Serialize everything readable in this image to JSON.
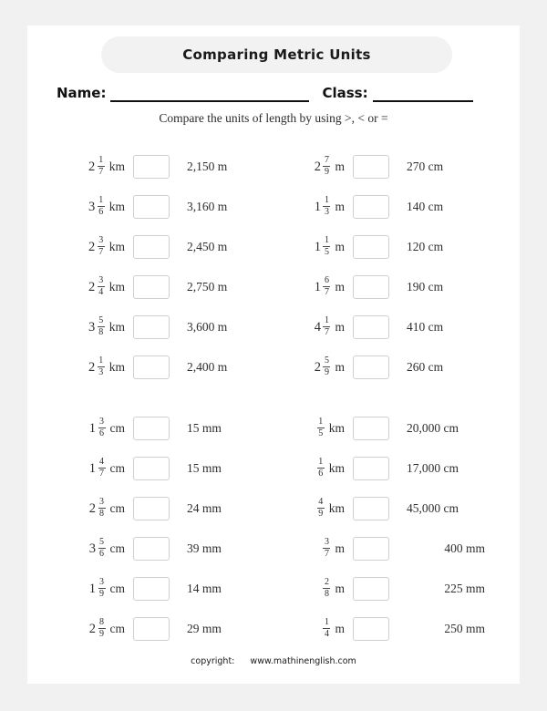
{
  "title": "Comparing Metric Units",
  "fields": {
    "name_label": "Name:",
    "class_label": "Class:"
  },
  "instruction": "Compare the units of length by using >, < or =",
  "footer": {
    "copyright_label": "copyright:",
    "site": "www.mathinenglish.com"
  },
  "blocks": [
    {
      "rows": [
        {
          "left": {
            "whole": "2",
            "num": "1",
            "den": "7",
            "unit": "km"
          },
          "answer": "",
          "right": "2,150 m",
          "right_align": false
        },
        {
          "left": {
            "whole": "3",
            "num": "1",
            "den": "6",
            "unit": "km"
          },
          "answer": "",
          "right": "3,160 m",
          "right_align": false
        },
        {
          "left": {
            "whole": "2",
            "num": "3",
            "den": "7",
            "unit": "km"
          },
          "answer": "",
          "right": "2,450 m",
          "right_align": false
        },
        {
          "left": {
            "whole": "2",
            "num": "3",
            "den": "4",
            "unit": "km"
          },
          "answer": "",
          "right": "2,750 m",
          "right_align": false
        },
        {
          "left": {
            "whole": "3",
            "num": "5",
            "den": "8",
            "unit": "km"
          },
          "answer": "",
          "right": "3,600 m",
          "right_align": false
        },
        {
          "left": {
            "whole": "2",
            "num": "1",
            "den": "3",
            "unit": "km"
          },
          "answer": "",
          "right": "2,400 m",
          "right_align": false
        }
      ],
      "rows_right": [
        {
          "left": {
            "whole": "2",
            "num": "7",
            "den": "9",
            "unit": "m"
          },
          "answer": "",
          "right": "270 cm",
          "right_align": false
        },
        {
          "left": {
            "whole": "1",
            "num": "1",
            "den": "3",
            "unit": "m"
          },
          "answer": "",
          "right": "140 cm",
          "right_align": false
        },
        {
          "left": {
            "whole": "1",
            "num": "1",
            "den": "5",
            "unit": "m"
          },
          "answer": "",
          "right": "120 cm",
          "right_align": false
        },
        {
          "left": {
            "whole": "1",
            "num": "6",
            "den": "7",
            "unit": "m"
          },
          "answer": "",
          "right": "190 cm",
          "right_align": false
        },
        {
          "left": {
            "whole": "4",
            "num": "1",
            "den": "7",
            "unit": "m"
          },
          "answer": "",
          "right": "410 cm",
          "right_align": false
        },
        {
          "left": {
            "whole": "2",
            "num": "5",
            "den": "9",
            "unit": "m"
          },
          "answer": "",
          "right": "260 cm",
          "right_align": false
        }
      ]
    },
    {
      "rows": [
        {
          "left": {
            "whole": "1",
            "num": "3",
            "den": "6",
            "unit": "cm"
          },
          "answer": "",
          "right": "15 mm",
          "right_align": false
        },
        {
          "left": {
            "whole": "1",
            "num": "4",
            "den": "7",
            "unit": "cm"
          },
          "answer": "",
          "right": "15 mm",
          "right_align": false
        },
        {
          "left": {
            "whole": "2",
            "num": "3",
            "den": "8",
            "unit": "cm"
          },
          "answer": "",
          "right": "24 mm",
          "right_align": false
        },
        {
          "left": {
            "whole": "3",
            "num": "5",
            "den": "6",
            "unit": "cm"
          },
          "answer": "",
          "right": "39 mm",
          "right_align": false
        },
        {
          "left": {
            "whole": "1",
            "num": "3",
            "den": "9",
            "unit": "cm"
          },
          "answer": "",
          "right": "14 mm",
          "right_align": false
        },
        {
          "left": {
            "whole": "2",
            "num": "8",
            "den": "9",
            "unit": "cm"
          },
          "answer": "",
          "right": "29 mm",
          "right_align": false
        }
      ],
      "rows_right": [
        {
          "left": {
            "whole": "",
            "num": "1",
            "den": "5",
            "unit": "km"
          },
          "answer": "",
          "right": "20,000 cm",
          "right_align": false
        },
        {
          "left": {
            "whole": "",
            "num": "1",
            "den": "6",
            "unit": "km"
          },
          "answer": "",
          "right": "17,000 cm",
          "right_align": false
        },
        {
          "left": {
            "whole": "",
            "num": "4",
            "den": "9",
            "unit": "km"
          },
          "answer": "",
          "right": "45,000 cm",
          "right_align": false
        },
        {
          "left": {
            "whole": "",
            "num": "3",
            "den": "7",
            "unit": "m"
          },
          "answer": "",
          "right": "400 mm",
          "right_align": true
        },
        {
          "left": {
            "whole": "",
            "num": "2",
            "den": "8",
            "unit": "m"
          },
          "answer": "",
          "right": "225 mm",
          "right_align": true
        },
        {
          "left": {
            "whole": "",
            "num": "1",
            "den": "4",
            "unit": "m"
          },
          "answer": "",
          "right": "250 mm",
          "right_align": true
        }
      ]
    }
  ]
}
